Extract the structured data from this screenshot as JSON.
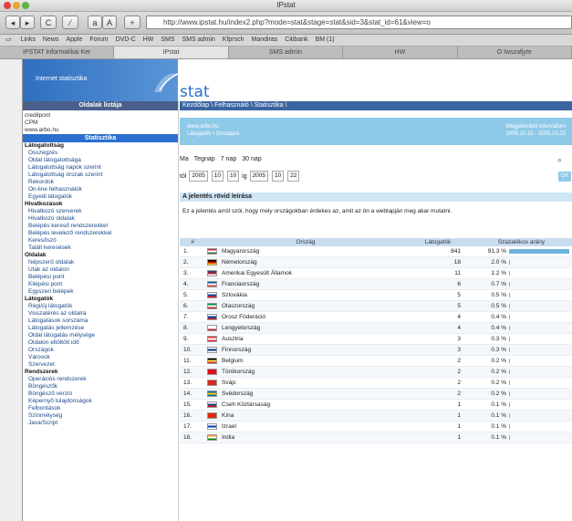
{
  "window": {
    "title": "IPstat"
  },
  "toolbar": {
    "back_label": "◂",
    "forward_label": "▸",
    "reload_label": "C",
    "tools_label": "⁄",
    "font_small_label": "a",
    "font_big_label": "A",
    "add_label": "+",
    "url": "http://www.ipstat.hu/index2.php?mode=stat&stage=stat&sid=3&stat_id=61&view=o"
  },
  "bookmarks": [
    "Links",
    "News",
    "Apple",
    "Forum",
    "DVD-C",
    "HW",
    "SMS",
    "SMS admin",
    "Kfprsch",
    "Mandiras",
    "Citibank",
    "BM (1)"
  ],
  "tabs": [
    "IPSTAT Informatikai Ker",
    "IPstat",
    "SMS admin",
    "HW",
    "O Iwszafjyte"
  ],
  "header": {
    "brand": "Internet statisztika",
    "logo_text": "stat"
  },
  "sidebar": {
    "head": "Oldalak listája",
    "top_items": [
      "credilpont",
      "CPM",
      "www.arbo.hu"
    ],
    "selected": "Statisztika",
    "groups": [
      {
        "title": "Látogatottság",
        "items": [
          "Összegzés",
          "Oldal látogatottsága",
          "Látogatottság napok szerint",
          "Látogatottság órszak szerint",
          "Rekordok",
          "On-line felhasználók",
          "Egyedi látogatók"
        ]
      },
      {
        "title": "Hivatkozások",
        "items": [
          "Hivatkozó szerverek",
          "Hivatkozó oldalak",
          "Belépés kereső rendszerekkel",
          "Belépés levelező rendszerekkel",
          "Keresőszó",
          "Talált keresések"
        ]
      },
      {
        "title": "Oldalak",
        "items": [
          "Népszerű oldalak",
          "Utak az oldalon",
          "Belépési pont",
          "Kilépési pont",
          "Egyszeri belépek"
        ]
      },
      {
        "title": "Látogatók",
        "items": [
          "Régi/új látogatók",
          "Visszatérés az oldalra",
          "Látogatások sorszáma",
          "Látogatás jellemzése",
          "Oldal látogatás mélysége",
          "Oldalon eltöltött idő",
          "Országok",
          "Városok",
          "Szervezet"
        ]
      },
      {
        "title": "Rendszerek",
        "items": [
          "Operációs rendszerek",
          "Böngészők",
          "Böngésző verzió",
          "Képernyő tulajdonságok",
          "Felbontások",
          "Színmélység",
          "Java/Script"
        ]
      }
    ]
  },
  "main": {
    "breadcrumb": "Kezdőlap \\ Felhasználó \\ Statisztika \\",
    "info_left_1": "www.arbo.hu",
    "info_left_2": "Látogatók • Országok",
    "info_right_1": "Megjelenített intervallum",
    "info_right_2": "2005.10.10 - 2005.10.22",
    "range_options": [
      "Ma",
      "Tegnap",
      "7 nap",
      "30 nap"
    ],
    "date_from_label": "tól",
    "date_from": [
      "2005",
      "10",
      "10"
    ],
    "date_to_label": "ig",
    "date_to": [
      "2005",
      "10",
      "22"
    ],
    "ok_label": "OK",
    "section_title": "A jelentés rövid leírása",
    "description": "Ez a jelentés arról szól, hogy mely országokban érdekes az, amit az ön a weblapján meg akar mutatni.",
    "table": {
      "headers": [
        "#",
        "Ország",
        "Látogatók",
        "Százalékos arány"
      ],
      "rows": [
        {
          "rank": "1.",
          "country": "Magyarország",
          "visits": "841",
          "pct": "91.3 %",
          "share": 91.3,
          "flag": [
            "#cd2a3e",
            "#ffffff",
            "#436f4d"
          ]
        },
        {
          "rank": "2.",
          "country": "Németország",
          "visits": "18",
          "pct": "2.0 %",
          "share": 2.0,
          "flag": [
            "#000000",
            "#dd0000",
            "#ffce00"
          ]
        },
        {
          "rank": "3.",
          "country": "Amerikai Egyesült Államok",
          "visits": "11",
          "pct": "1.2 %",
          "share": 1.2,
          "flag": [
            "#3c3b6e",
            "#b22234",
            "#ffffff"
          ]
        },
        {
          "rank": "4.",
          "country": "Franciaország",
          "visits": "6",
          "pct": "0.7 %",
          "share": 0.7,
          "flag": [
            "#0055a4",
            "#ffffff",
            "#ef4135"
          ]
        },
        {
          "rank": "5.",
          "country": "Szlovákia",
          "visits": "5",
          "pct": "0.5 %",
          "share": 0.5,
          "flag": [
            "#ffffff",
            "#0b4ea2",
            "#ee1c25"
          ]
        },
        {
          "rank": "6.",
          "country": "Olaszország",
          "visits": "5",
          "pct": "0.5 %",
          "share": 0.5,
          "flag": [
            "#009246",
            "#ffffff",
            "#ce2b37"
          ]
        },
        {
          "rank": "7.",
          "country": "Orosz Föderáció",
          "visits": "4",
          "pct": "0.4 %",
          "share": 0.4,
          "flag": [
            "#ffffff",
            "#0039a6",
            "#d52b1e"
          ]
        },
        {
          "rank": "8.",
          "country": "Lengyelország",
          "visits": "4",
          "pct": "0.4 %",
          "share": 0.4,
          "flag": [
            "#ffffff",
            "#ffffff",
            "#dc143c"
          ]
        },
        {
          "rank": "9.",
          "country": "Ausztria",
          "visits": "3",
          "pct": "0.3 %",
          "share": 0.3,
          "flag": [
            "#ed2939",
            "#ffffff",
            "#ed2939"
          ]
        },
        {
          "rank": "10.",
          "country": "Finnország",
          "visits": "3",
          "pct": "0.3 %",
          "share": 0.3,
          "flag": [
            "#ffffff",
            "#003580",
            "#ffffff"
          ]
        },
        {
          "rank": "11.",
          "country": "Belgium",
          "visits": "2",
          "pct": "0.2 %",
          "share": 0.2,
          "flag": [
            "#000000",
            "#fae042",
            "#ed2939"
          ]
        },
        {
          "rank": "12.",
          "country": "Törökország",
          "visits": "2",
          "pct": "0.2 %",
          "share": 0.2,
          "flag": [
            "#e30a17",
            "#e30a17",
            "#e30a17"
          ]
        },
        {
          "rank": "13.",
          "country": "Svájc",
          "visits": "2",
          "pct": "0.2 %",
          "share": 0.2,
          "flag": [
            "#d52b1e",
            "#d52b1e",
            "#d52b1e"
          ]
        },
        {
          "rank": "14.",
          "country": "Svédország",
          "visits": "2",
          "pct": "0.2 %",
          "share": 0.2,
          "flag": [
            "#006aa7",
            "#fecc00",
            "#006aa7"
          ]
        },
        {
          "rank": "15.",
          "country": "Cseh Köztársaság",
          "visits": "1",
          "pct": "0.1 %",
          "share": 0.1,
          "flag": [
            "#ffffff",
            "#11457e",
            "#d7141a"
          ]
        },
        {
          "rank": "16.",
          "country": "Kína",
          "visits": "1",
          "pct": "0.1 %",
          "share": 0.1,
          "flag": [
            "#de2910",
            "#de2910",
            "#de2910"
          ]
        },
        {
          "rank": "17.",
          "country": "Izrael",
          "visits": "1",
          "pct": "0.1 %",
          "share": 0.1,
          "flag": [
            "#ffffff",
            "#0038b8",
            "#ffffff"
          ]
        },
        {
          "rank": "18.",
          "country": "India",
          "visits": "1",
          "pct": "0.1 %",
          "share": 0.1,
          "flag": [
            "#ff9933",
            "#ffffff",
            "#138808"
          ]
        }
      ]
    }
  },
  "colors": {
    "accent": "#2c6fce",
    "bar": "#6fb3e0",
    "info": "#8fc9e8"
  }
}
